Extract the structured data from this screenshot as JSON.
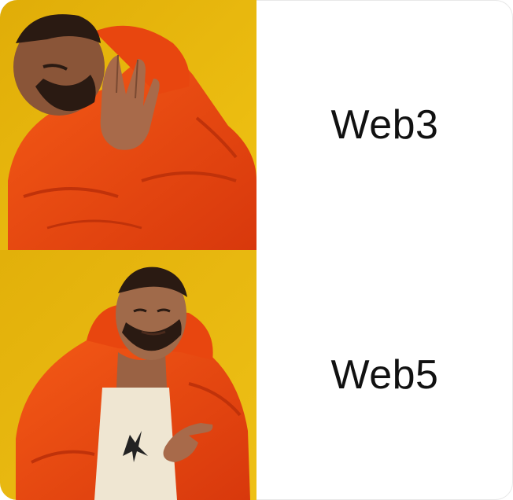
{
  "meme": {
    "rows": [
      {
        "reaction": "reject",
        "label": "Web3"
      },
      {
        "reaction": "approve",
        "label": "Web5"
      }
    ]
  },
  "colors": {
    "background_yellow": "#e6b70c",
    "jacket_orange": "#f04e10",
    "skin": "#a0684a",
    "text": "#111111"
  }
}
